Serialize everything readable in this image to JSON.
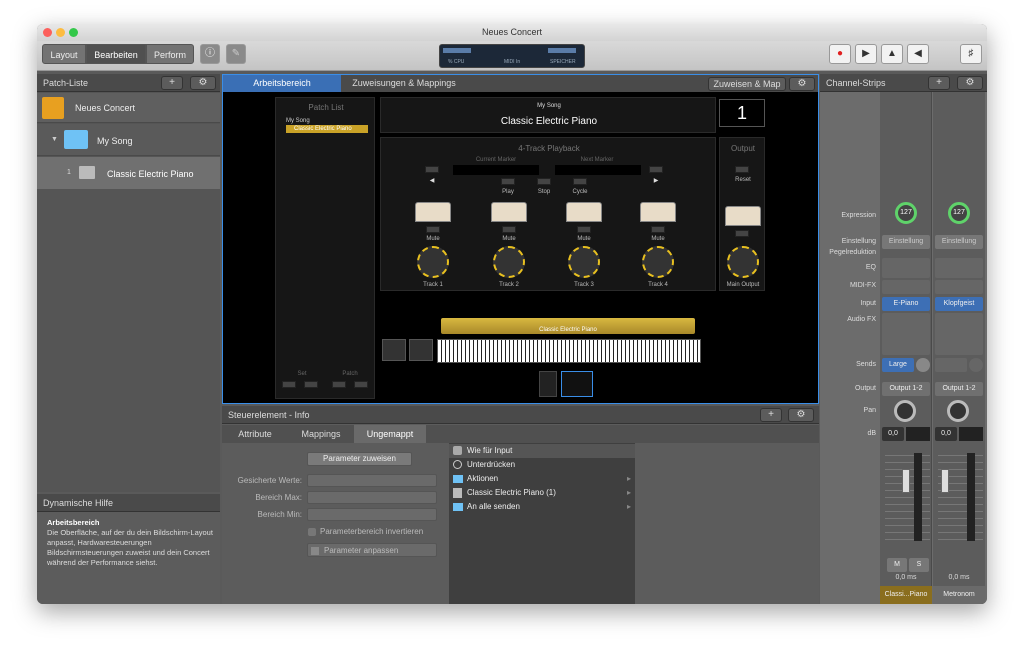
{
  "window_title": "Neues Concert",
  "toolbar": {
    "modes": [
      "Layout",
      "Bearbeiten",
      "Perform"
    ],
    "lcd": {
      "cpu": "% CPU",
      "midi": "MIDI In",
      "memory": "SPEICHER"
    }
  },
  "patch_list": {
    "header": "Patch-Liste",
    "items": [
      {
        "label": "Neues Concert"
      },
      {
        "label": "My Song"
      },
      {
        "number": "1",
        "label": "Classic Electric Piano"
      }
    ]
  },
  "help": {
    "header": "Dynamische Hilfe",
    "title": "Arbeitsbereich",
    "text": "Die Oberfläche, auf der du dein Bildschirm-Layout anpasst, Hardwaresteuerungen Bildschirmsteuerungen zuweist und dein Concert während der Performance siehst."
  },
  "tabs": {
    "workspace": "Arbeitsbereich",
    "mappings": "Zuweisungen & Mappings",
    "assign_map": "Zuweisen & Map"
  },
  "stage": {
    "patch_list_title": "Patch List",
    "song": "My Song",
    "patch": "Classic Electric Piano",
    "song_small": "My Song",
    "patch_title": "Classic Electric Piano",
    "patch_number": "1",
    "playback_title": "4-Track Playback",
    "current_marker": "Current Marker",
    "next_marker": "Next Marker",
    "play": "Play",
    "stop": "Stop",
    "cycle": "Cycle",
    "mute": "Mute",
    "tracks": [
      "Track 1",
      "Track 2",
      "Track 3",
      "Track 4"
    ],
    "output_title": "Output",
    "reset": "Reset",
    "main_output": "Main Output",
    "keyboard_label": "Classic Electric Piano",
    "set": "Set",
    "patch_lbl": "Patch"
  },
  "channel_strips": {
    "header": "Channel-Strips",
    "labels": [
      "Expression",
      "Einstellung",
      "Pegelreduktion",
      "EQ",
      "MIDI-FX",
      "Input",
      "Audio FX",
      "Sends",
      "Output",
      "Pan",
      "dB"
    ],
    "strip1": {
      "expression": "127",
      "setting": "Einstellung",
      "input": "E-Piano",
      "send": "Large",
      "output": "Output 1-2",
      "db": "0,0",
      "ms": "0,0 ms",
      "name": "Classi...Piano"
    },
    "strip2": {
      "expression": "127",
      "setting": "Einstellung",
      "input": "Klopfgeist",
      "output": "Output 1-2",
      "db": "0,0",
      "ms": "0,0 ms",
      "name": "Metronom"
    },
    "m": "M",
    "s": "S"
  },
  "control": {
    "header": "Steuerelement - Info",
    "tabs": [
      "Attribute",
      "Mappings",
      "Ungemappt"
    ],
    "assign_button": "Parameter zuweisen",
    "fields": [
      "Gesicherte Werte:",
      "Bereich Max:",
      "Bereich Min:"
    ],
    "invert": "Parameterbereich invertieren",
    "adapt": "Parameter anpassen",
    "list": [
      "Wie für Input",
      "Unterdrücken",
      "Aktionen",
      "Classic Electric Piano (1)",
      "An alle senden"
    ]
  },
  "colors": {
    "accent": "#3a8ee8",
    "gold": "#c9a227",
    "blue_btn": "#3d6fb5",
    "green_knob": "#5fd36a"
  }
}
